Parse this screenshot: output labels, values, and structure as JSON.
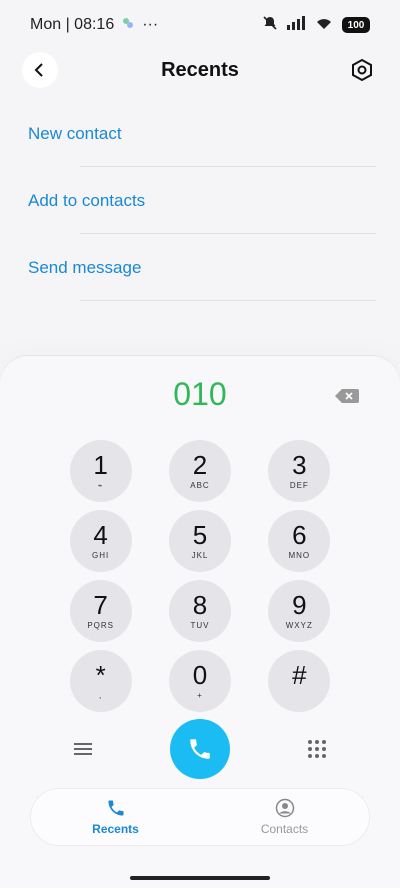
{
  "status_bar": {
    "day_time": "Mon | 08:16",
    "dots": "···",
    "battery": "100"
  },
  "header": {
    "title": "Recents"
  },
  "actions": [
    {
      "label": "New contact"
    },
    {
      "label": "Add to contacts"
    },
    {
      "label": "Send message"
    }
  ],
  "dialer": {
    "number": "010",
    "keys": [
      [
        {
          "digit": "1",
          "letters": "⌁"
        },
        {
          "digit": "2",
          "letters": "ABC"
        },
        {
          "digit": "3",
          "letters": "DEF"
        }
      ],
      [
        {
          "digit": "4",
          "letters": "GHI"
        },
        {
          "digit": "5",
          "letters": "JKL"
        },
        {
          "digit": "6",
          "letters": "MNO"
        }
      ],
      [
        {
          "digit": "7",
          "letters": "PQRS"
        },
        {
          "digit": "8",
          "letters": "TUV"
        },
        {
          "digit": "9",
          "letters": "WXYZ"
        }
      ],
      [
        {
          "digit": "*",
          "letters": ","
        },
        {
          "digit": "0",
          "letters": "+"
        },
        {
          "digit": "#",
          "letters": ""
        }
      ]
    ]
  },
  "bottom_nav": {
    "items": [
      {
        "label": "Recents",
        "icon": "phone-icon"
      },
      {
        "label": "Contacts",
        "icon": "person-circle-icon"
      }
    ]
  },
  "colors": {
    "accent_blue": "#1a88d4",
    "number_green": "#2fb857",
    "call_button": "#1bbcf4"
  }
}
